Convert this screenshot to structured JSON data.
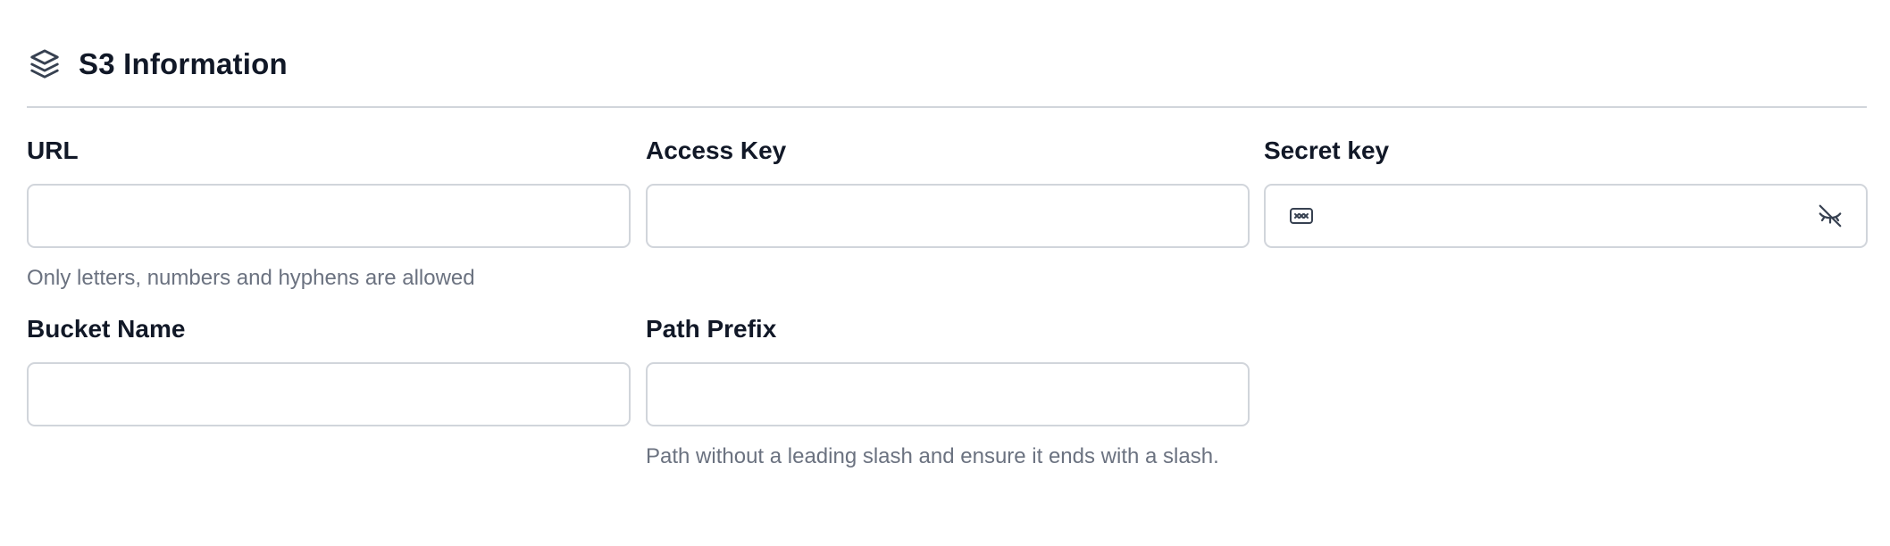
{
  "section": {
    "title": "S3 Information",
    "icon": "layers-icon"
  },
  "fields": {
    "url": {
      "label": "URL",
      "value": "",
      "help": "Only letters, numbers and hyphens are allowed"
    },
    "access_key": {
      "label": "Access Key",
      "value": ""
    },
    "secret_key": {
      "label": "Secret key",
      "value": "",
      "lead_icon": "password-icon",
      "toggle_icon": "eye-off-icon"
    },
    "bucket_name": {
      "label": "Bucket Name",
      "value": ""
    },
    "path_prefix": {
      "label": "Path Prefix",
      "value": "",
      "help": "Path without a leading slash and ensure it ends with a slash."
    }
  },
  "colors": {
    "text": "#111827",
    "muted": "#6b7280",
    "border": "#d1d5db"
  }
}
